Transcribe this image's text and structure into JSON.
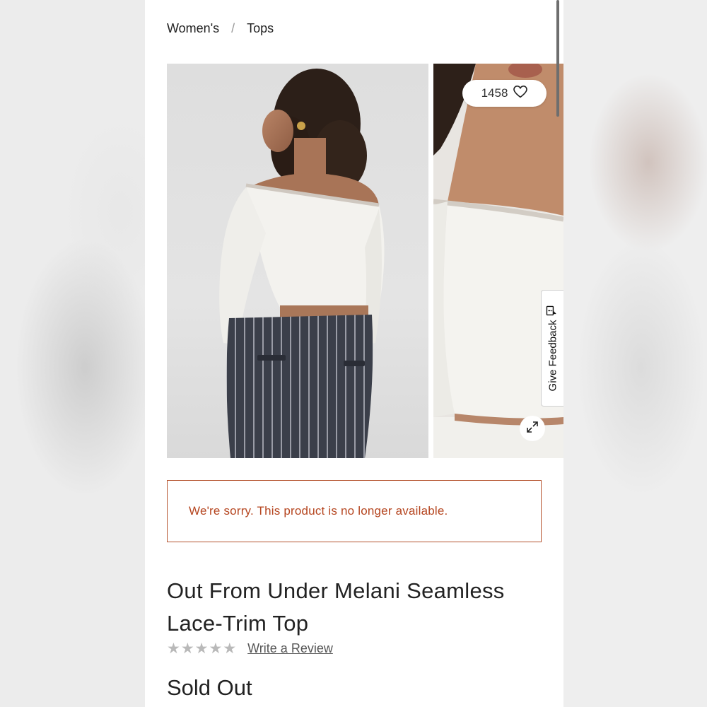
{
  "breadcrumb": {
    "items": [
      "Women's",
      "Tops"
    ],
    "separator": "/"
  },
  "gallery": {
    "likes_count": "1458",
    "image_count": 4,
    "active_image_index": 2,
    "feedback_label": "Give Feedback",
    "icons": [
      "heart-icon",
      "expand-icon",
      "feedback-icon"
    ]
  },
  "alert": {
    "message": "We're sorry. This product is no longer available.",
    "border_color": "#b5532e",
    "text_color": "#b5451f"
  },
  "product": {
    "title_line1": "Out From Under Melani Seamless",
    "title_line2": "Lace-Trim Top",
    "rating_stars": 0,
    "review_link": "Write a Review",
    "status": "Sold Out"
  }
}
